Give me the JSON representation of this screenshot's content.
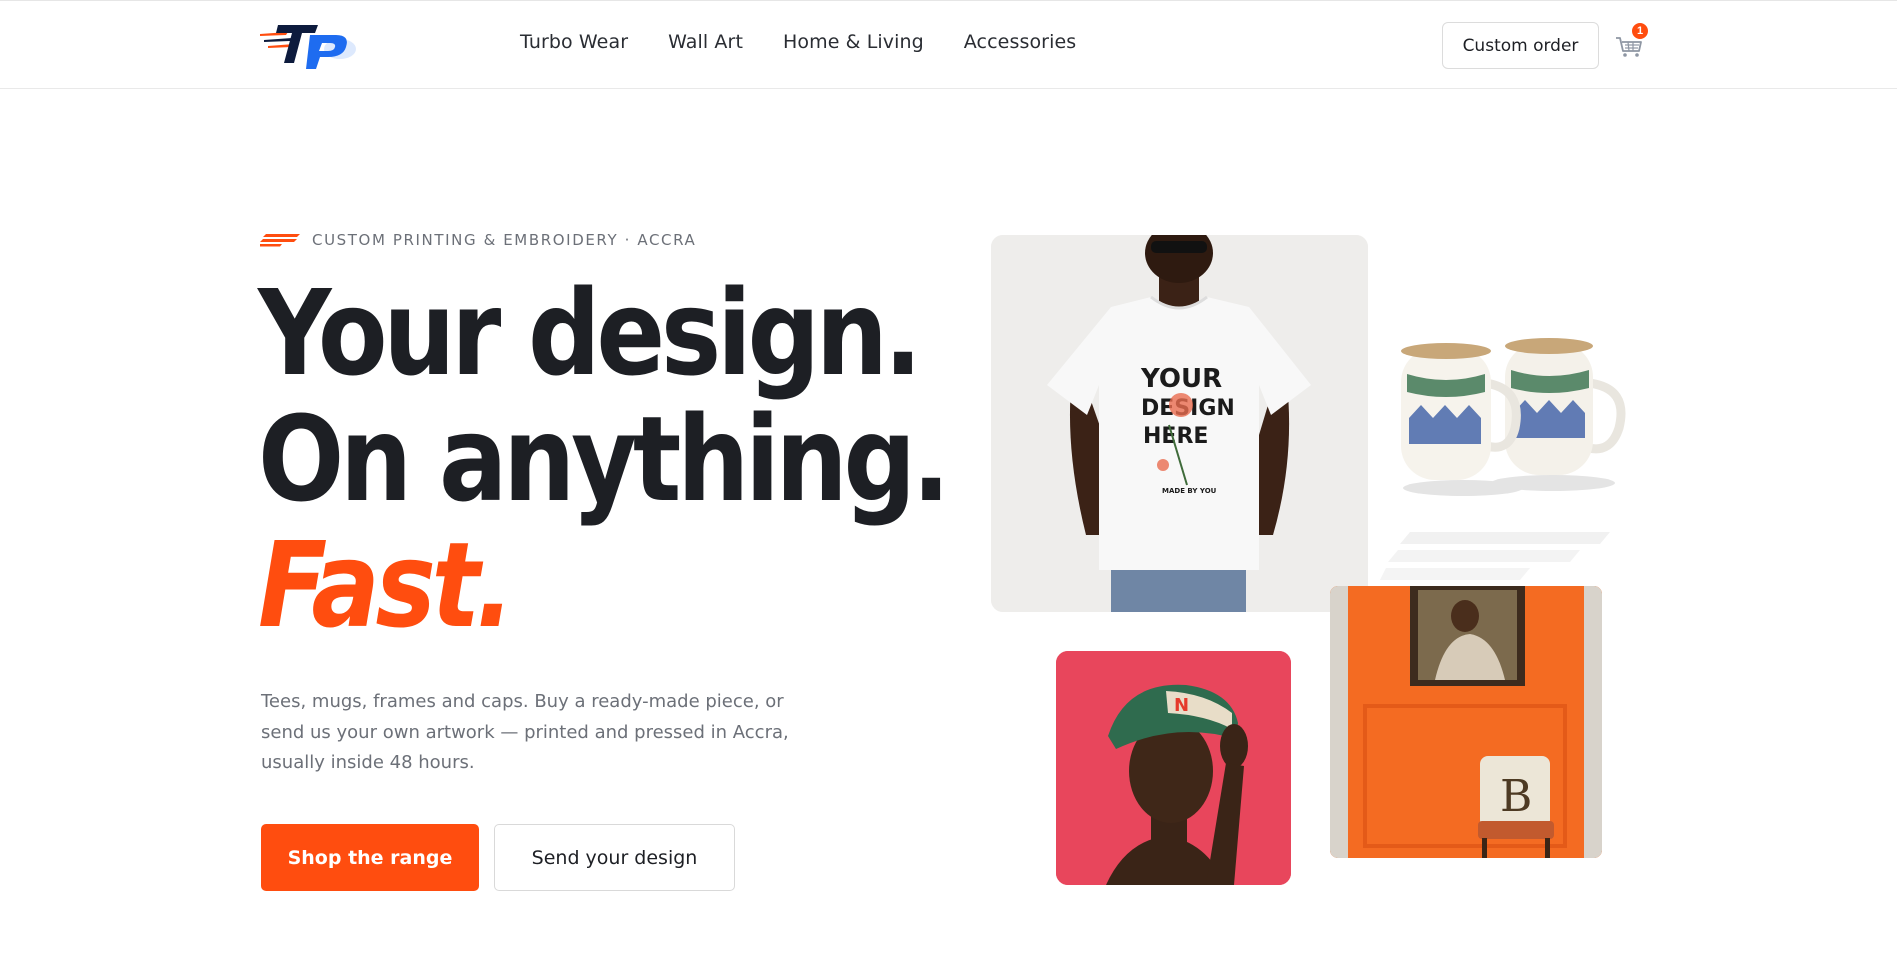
{
  "header": {
    "logo_text": "TP",
    "nav": [
      {
        "label": "Turbo Wear"
      },
      {
        "label": "Wall Art"
      },
      {
        "label": "Home & Living"
      },
      {
        "label": "Accessories"
      }
    ],
    "custom_order_label": "Custom order",
    "cart_count": "1",
    "cart_icon": "cart-icon"
  },
  "hero": {
    "eyebrow": "CUSTOM PRINTING & EMBROIDERY · ACCRA",
    "headline_line1": "Your design.",
    "headline_line2": "On anything.",
    "headline_accent": "Fast.",
    "subtext": "Tees, mugs, frames and caps. Buy a ready-made piece, or send us your own artwork — printed and pressed in Accra, usually inside 48 hours.",
    "primary_cta": "Shop the range",
    "secondary_cta": "Send your design"
  },
  "gallery": {
    "tee_print_line1": "YOUR",
    "tee_print_line2": "DESIGN",
    "tee_print_line3": "HERE",
    "tee_print_small": "MADE BY YOU",
    "pillow_letter": "B"
  },
  "colors": {
    "accent": "#ff4d0f",
    "text": "#1d1f24",
    "muted": "#6c7078",
    "logo_blue": "#1e6cf0",
    "logo_navy": "#0d1b3d"
  }
}
